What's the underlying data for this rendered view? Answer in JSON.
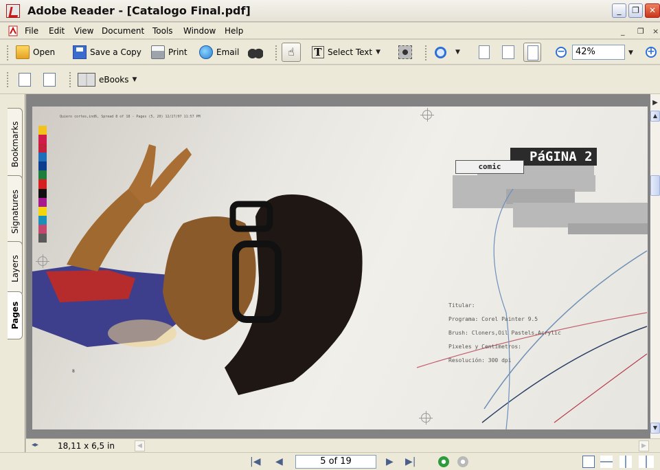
{
  "window": {
    "title": "Adobe Reader - [Catalogo Final.pdf]",
    "controls": [
      "_",
      "❐",
      "✕"
    ]
  },
  "menu": {
    "items": [
      "File",
      "Edit",
      "View",
      "Document",
      "Tools",
      "Window",
      "Help"
    ],
    "mdi_controls": [
      "_",
      "❐",
      "×"
    ]
  },
  "toolbar1": {
    "open_label": "Open",
    "save_copy_label": "Save a Copy",
    "print_label": "Print",
    "email_label": "Email",
    "hand_glyph": "☝",
    "select_text_label": "Select Text",
    "zoom_value": "42%"
  },
  "toolbar2": {
    "ebooks_label": "eBooks"
  },
  "nav_tabs": [
    "Bookmarks",
    "Signatures",
    "Layers",
    "Pages"
  ],
  "document": {
    "page_header": "Quiero cortes,ind6, Spread 8 of 18 - Pages (5, 20) 12/27/07 11:57 PM",
    "pagina_label": "PáGINA 2",
    "comic_label": "comic",
    "spec_lines": [
      "Titular:",
      "Programa: Corel Painter 9.5",
      "Brush: Cloners,Oil Pastels,Acrylic",
      "Pixeles y Centímetros:",
      "Resolución: 300 dpi"
    ],
    "page_marker": "8"
  },
  "status": {
    "page_size": "18,11 x 6,5 in",
    "page_indicator": "5 of 19"
  },
  "colors": {
    "colorbar": [
      "#f2c31a",
      "#d01c4a",
      "#c2203b",
      "#1c6fb8",
      "#0d3d8c",
      "#1c7d3c",
      "#d61f1f",
      "#111111",
      "#a8188e",
      "#f4d50e",
      "#1b8fb8",
      "#c5476d",
      "#5a5a5a"
    ]
  }
}
